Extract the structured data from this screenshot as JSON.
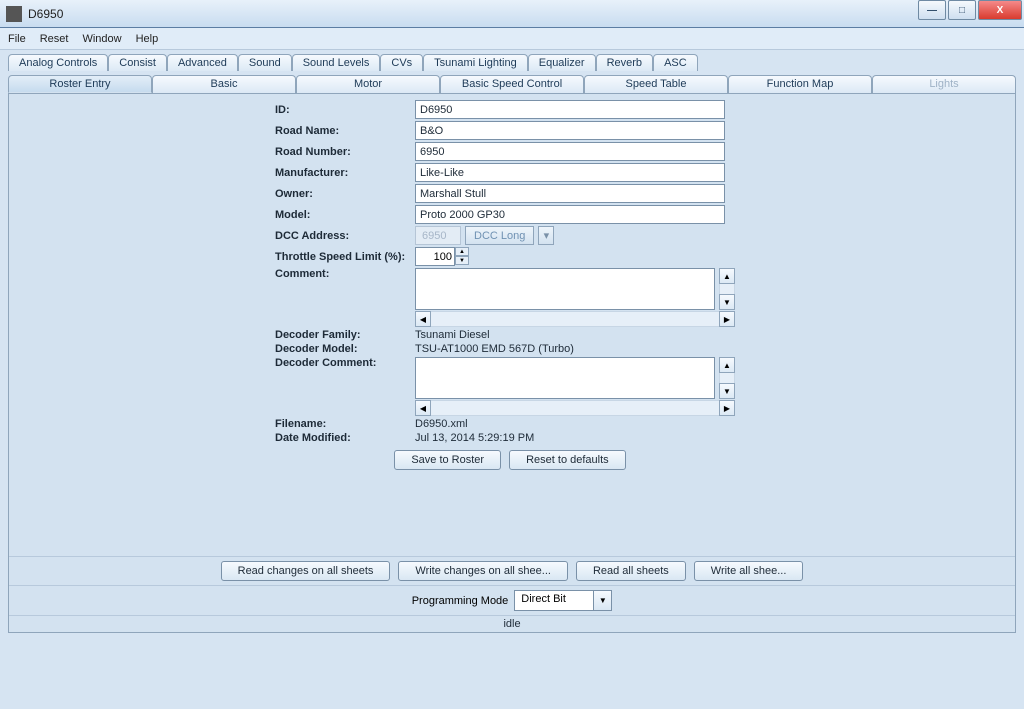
{
  "title": "D6950",
  "menu": {
    "file": "File",
    "reset": "Reset",
    "window": "Window",
    "help": "Help"
  },
  "tabs_top": [
    "Analog Controls",
    "Consist",
    "Advanced",
    "Sound",
    "Sound Levels",
    "CVs",
    "Tsunami Lighting",
    "Equalizer",
    "Reverb",
    "ASC"
  ],
  "tabs_bottom": [
    "Roster Entry",
    "Basic",
    "Motor",
    "Basic Speed Control",
    "Speed Table",
    "Function Map",
    "Lights"
  ],
  "selected_tab": "Roster Entry",
  "form": {
    "id_label": "ID:",
    "id": "D6950",
    "road_name_label": "Road Name:",
    "road_name": "B&O",
    "road_number_label": "Road Number:",
    "road_number": "6950",
    "manufacturer_label": "Manufacturer:",
    "manufacturer": "Like-Like",
    "owner_label": "Owner:",
    "owner": "Marshall Stull",
    "model_label": "Model:",
    "model": "Proto 2000 GP30",
    "dcc_address_label": "DCC Address:",
    "dcc_address": "6950",
    "dcc_mode": "DCC Long",
    "throttle_label": "Throttle Speed Limit (%):",
    "throttle": "100",
    "comment_label": "Comment:",
    "comment": "",
    "decoder_family_label": "Decoder Family:",
    "decoder_family": "Tsunami Diesel",
    "decoder_model_label": "Decoder Model:",
    "decoder_model": "TSU-AT1000 EMD 567D (Turbo)",
    "decoder_comment_label": "Decoder Comment:",
    "decoder_comment": "",
    "filename_label": "Filename:",
    "filename": "D6950.xml",
    "date_modified_label": "Date Modified:",
    "date_modified": "Jul 13, 2014 5:29:19 PM"
  },
  "buttons": {
    "save": "Save to Roster",
    "reset": "Reset to defaults"
  },
  "bottom_buttons": {
    "read_changes": "Read changes on all sheets",
    "write_changes": "Write changes on all shee...",
    "read_all": "Read all sheets",
    "write_all": "Write all shee..."
  },
  "programming_mode_label": "Programming Mode",
  "programming_mode": "Direct Bit",
  "status": "idle"
}
